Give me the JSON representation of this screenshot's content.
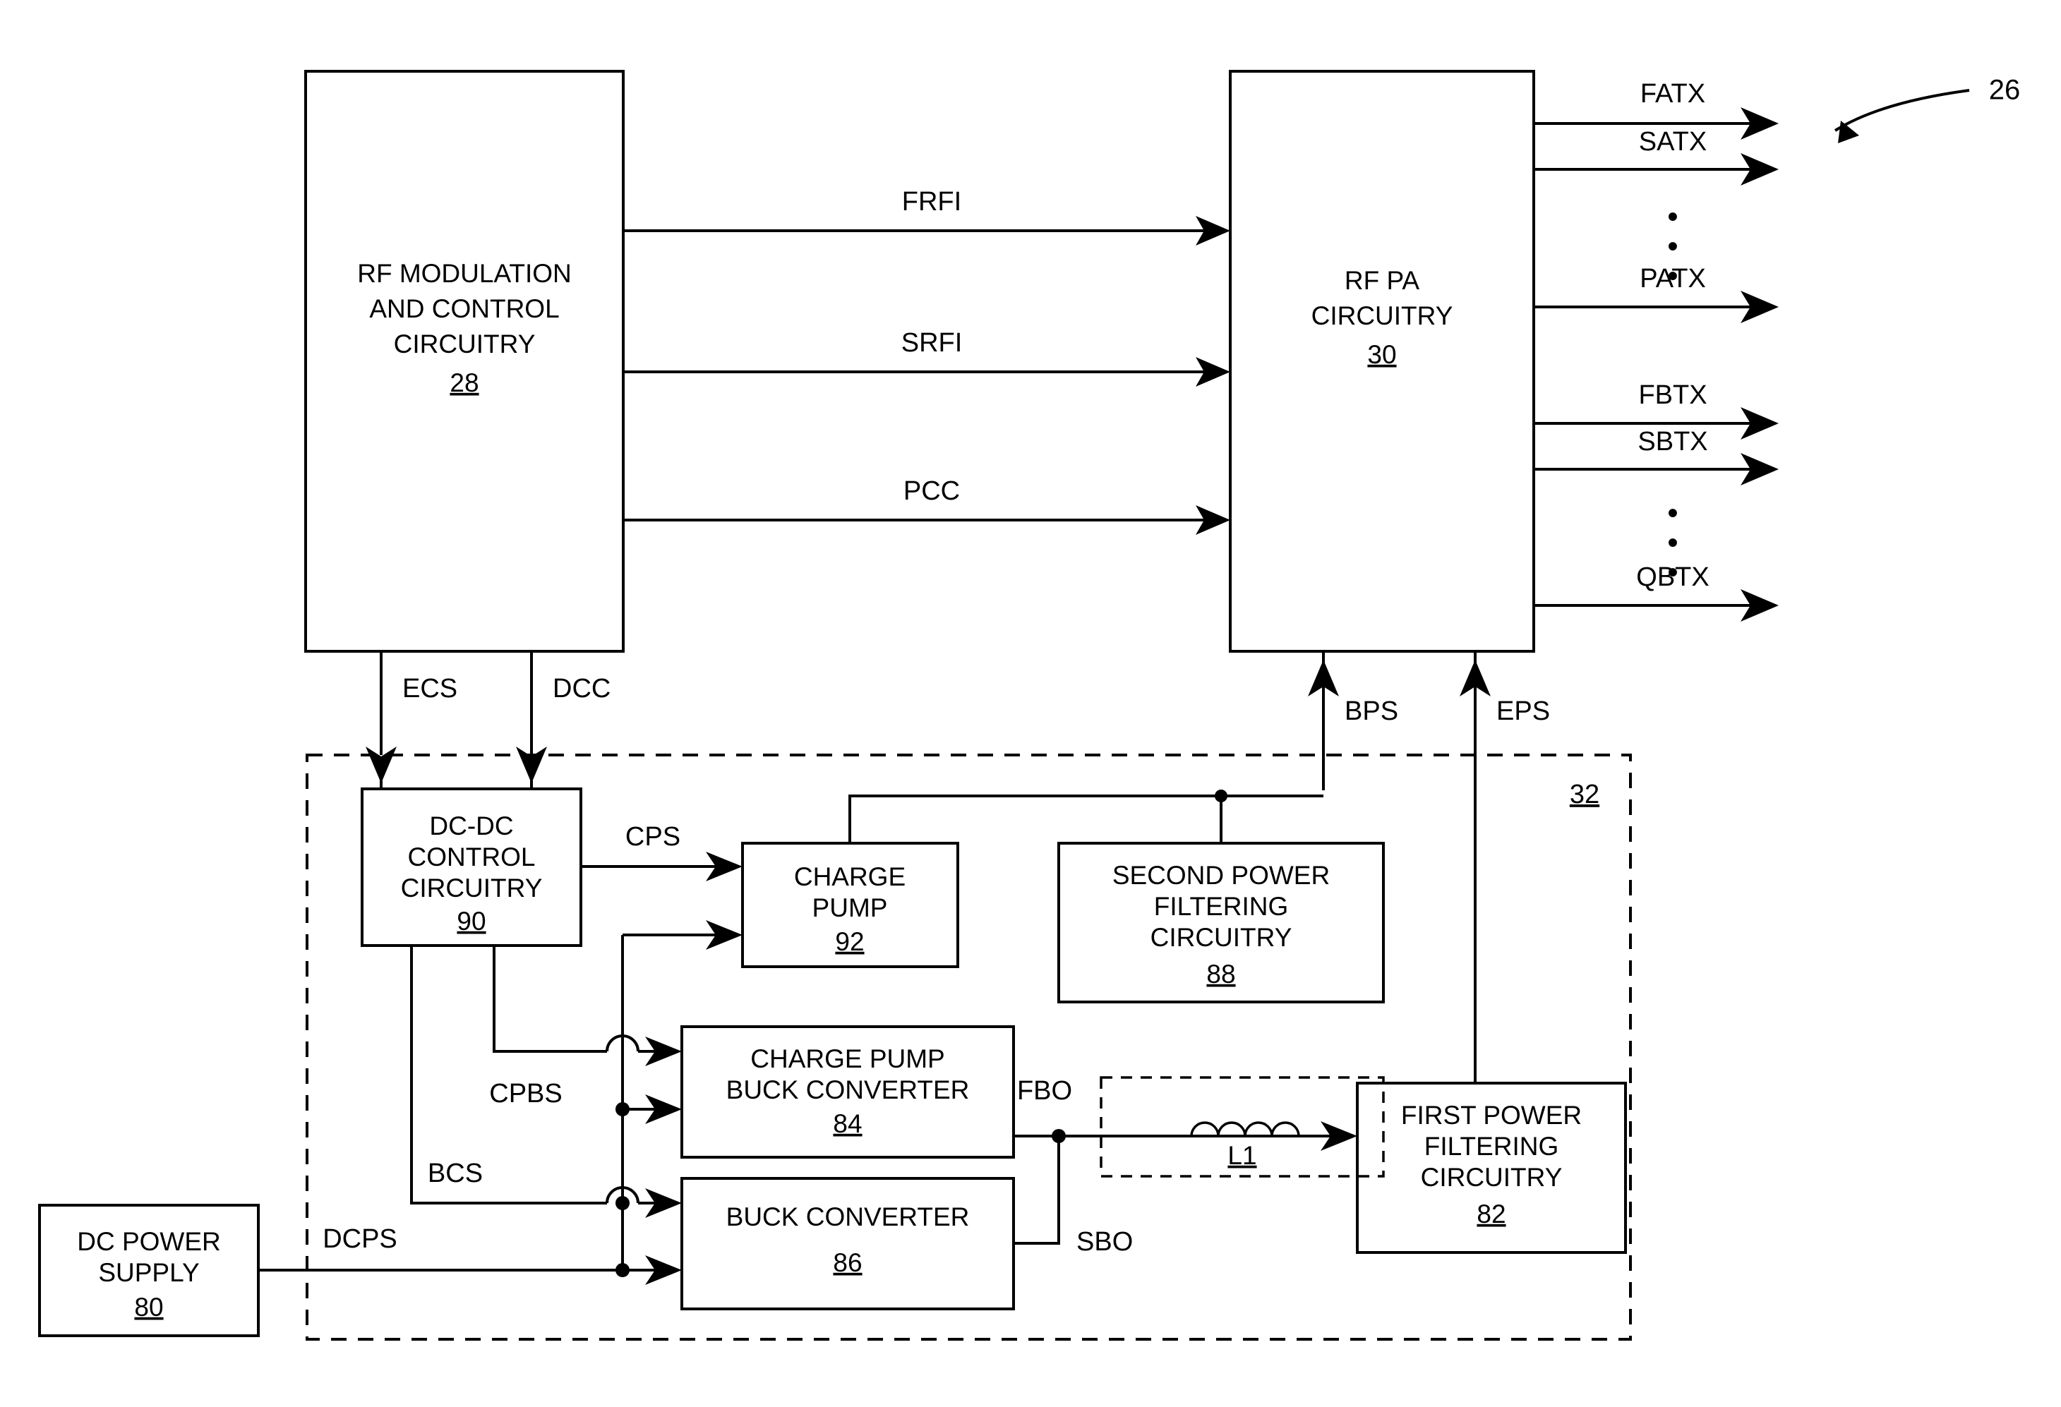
{
  "figure": {
    "reference_numeral": "26",
    "subsystem_numeral": "32"
  },
  "blocks": {
    "rf_modulation": {
      "lines": [
        "RF MODULATION",
        "AND CONTROL",
        "CIRCUITRY"
      ],
      "num": "28"
    },
    "rf_pa": {
      "lines": [
        "RF PA",
        "CIRCUITRY"
      ],
      "num": "30"
    },
    "dcdc_control": {
      "lines": [
        "DC-DC",
        "CONTROL",
        "CIRCUITRY"
      ],
      "num": "90"
    },
    "charge_pump": {
      "lines": [
        "CHARGE",
        "PUMP"
      ],
      "num": "92"
    },
    "second_power_filtering": {
      "lines": [
        "SECOND POWER",
        "FILTERING",
        "CIRCUITRY"
      ],
      "num": "88"
    },
    "charge_pump_buck_converter": {
      "lines": [
        "CHARGE PUMP",
        "BUCK CONVERTER"
      ],
      "num": "84"
    },
    "buck_converter": {
      "lines": [
        "BUCK CONVERTER"
      ],
      "num": "86"
    },
    "first_power_filtering": {
      "lines": [
        "FIRST POWER",
        "FILTERING",
        "CIRCUITRY"
      ],
      "num": "82"
    },
    "dc_power_supply": {
      "lines": [
        "DC POWER",
        "SUPPLY"
      ],
      "num": "80"
    },
    "inductor": {
      "num": "L1"
    }
  },
  "signals": {
    "frfi": "FRFI",
    "srfi": "SRFI",
    "pcc": "PCC",
    "ecs": "ECS",
    "dcc": "DCC",
    "bps": "BPS",
    "eps": "EPS",
    "cps": "CPS",
    "cpbs": "CPBS",
    "bcs": "BCS",
    "dcps": "DCPS",
    "fbo": "FBO",
    "sbo": "SBO"
  },
  "outputs": {
    "group_a": [
      "FATX",
      "SATX",
      "PATX"
    ],
    "group_b": [
      "FBTX",
      "SBTX",
      "QBTX"
    ],
    "ellipsis": "•"
  },
  "colors": {
    "stroke": "#000000",
    "background": "#ffffff"
  }
}
